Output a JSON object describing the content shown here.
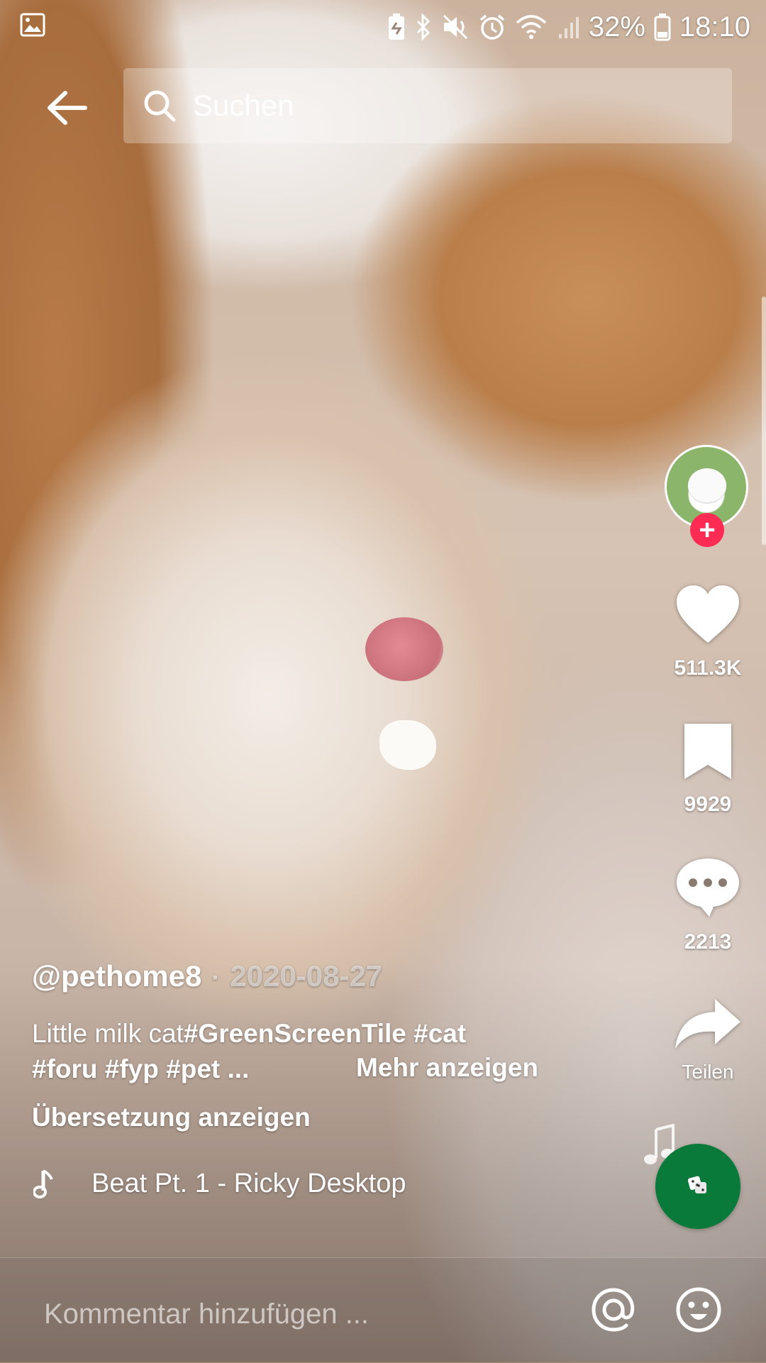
{
  "status_bar": {
    "battery_percent": "32%",
    "time": "18:10",
    "icons": [
      "gallery-icon",
      "battery-saver-icon",
      "bluetooth-icon",
      "mute-icon",
      "alarm-icon",
      "wifi-icon",
      "signal-icon",
      "battery-icon"
    ]
  },
  "search": {
    "placeholder": "Suchen"
  },
  "post": {
    "username": "@pethome8",
    "date": "2020-08-27",
    "caption_line1_text": "Little milk cat",
    "caption_line1_tags": "#GreenScreenTile #cat",
    "caption_line2": "#foru #fyp #pet ...",
    "more_label": "Mehr anzeigen",
    "translate_label": "Übersetzung anzeigen",
    "music_title": "Beat Pt. 1 - Ricky Desktop"
  },
  "actions": {
    "follow_symbol": "+",
    "likes": "511.3K",
    "saves": "9929",
    "comments": "2213",
    "share_label": "Teilen"
  },
  "comment_bar": {
    "placeholder": "Kommentar hinzufügen ..."
  },
  "colors": {
    "accent": "#fe2c55",
    "disc": "#0a7a3a"
  }
}
